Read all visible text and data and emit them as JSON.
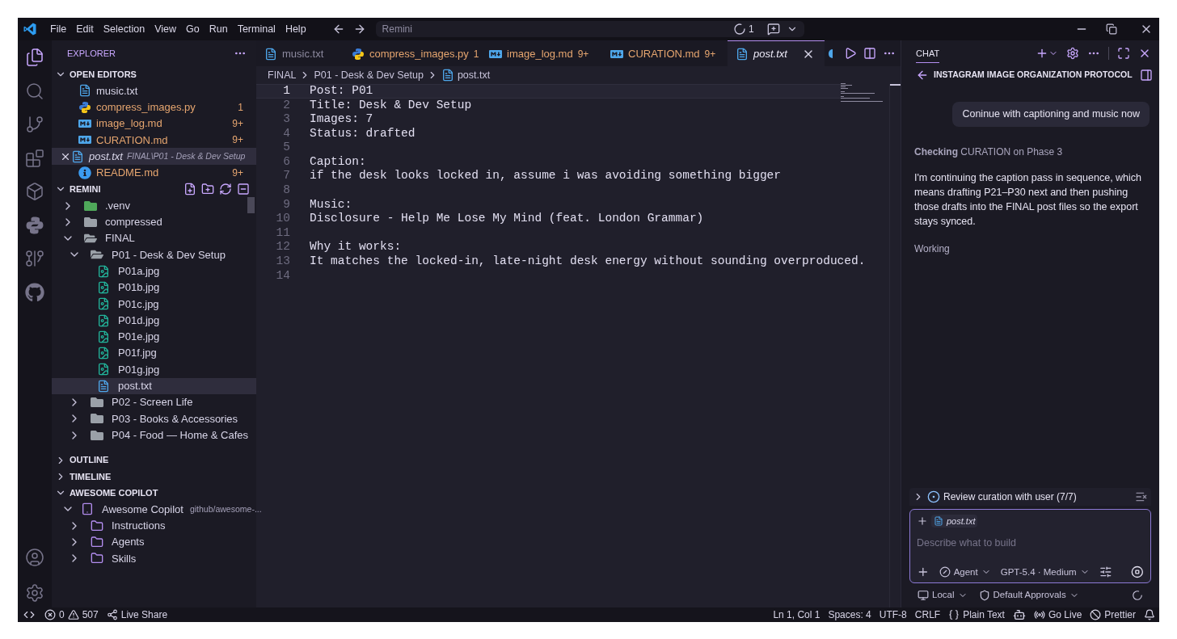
{
  "title_bar": {
    "menu": [
      "File",
      "Edit",
      "Selection",
      "View",
      "Go",
      "Run",
      "Terminal",
      "Help"
    ],
    "search": {
      "value": "Remini"
    },
    "progress_count": "1"
  },
  "activity_bar": {
    "top": [
      {
        "kind": "files",
        "selected": true
      },
      {
        "kind": "search",
        "selected": false
      },
      {
        "kind": "source-control",
        "selected": false
      },
      {
        "kind": "extensions",
        "selected": false
      },
      {
        "kind": "package",
        "selected": false
      },
      {
        "kind": "python",
        "selected": false
      },
      {
        "kind": "git-graph",
        "selected": false
      },
      {
        "kind": "github",
        "selected": false
      }
    ],
    "bottom": [
      {
        "kind": "account"
      },
      {
        "kind": "settings"
      }
    ]
  },
  "sidebar": {
    "title": "EXPLORER",
    "open_editors": {
      "label": "OPEN EDITORS",
      "expanded": true,
      "items": [
        {
          "name": "music.txt",
          "kind": "text",
          "modified": false,
          "preview": false,
          "selected": false
        },
        {
          "name": "compress_images.py",
          "kind": "python",
          "modified": true,
          "preview": false,
          "selected": false,
          "badge": "1"
        },
        {
          "name": "image_log.md",
          "kind": "markdown",
          "modified": true,
          "preview": false,
          "selected": false,
          "badge": "9+"
        },
        {
          "name": "CURATION.md",
          "kind": "markdown",
          "modified": true,
          "preview": false,
          "selected": false,
          "badge": "9+"
        },
        {
          "name": "post.txt",
          "kind": "text",
          "modified": false,
          "preview": true,
          "selected": true,
          "description": "FINAL\\P01 - Desk & Dev Setup"
        },
        {
          "name": "README.md",
          "kind": "info",
          "modified": true,
          "preview": false,
          "selected": false,
          "badge": "9+"
        }
      ]
    },
    "folder": {
      "label": "REMINI",
      "expanded": true,
      "tree": [
        {
          "name": ".venv",
          "kind": "venv",
          "expanded": false,
          "selected": false
        },
        {
          "name": "compressed",
          "kind": "folder",
          "expanded": false,
          "selected": false
        },
        {
          "name": "FINAL",
          "kind": "folder",
          "expanded": true,
          "selected": false,
          "children": [
            {
              "name": "P01 - Desk & Dev Setup",
              "kind": "folder",
              "expanded": true,
              "selected": false,
              "children": [
                {
                  "name": "P01a.jpg",
                  "kind": "image",
                  "selected": false
                },
                {
                  "name": "P01b.jpg",
                  "kind": "image",
                  "selected": false
                },
                {
                  "name": "P01c.jpg",
                  "kind": "image",
                  "selected": false
                },
                {
                  "name": "P01d.jpg",
                  "kind": "image",
                  "selected": false
                },
                {
                  "name": "P01e.jpg",
                  "kind": "image",
                  "selected": false
                },
                {
                  "name": "P01f.jpg",
                  "kind": "image",
                  "selected": false
                },
                {
                  "name": "P01g.jpg",
                  "kind": "image",
                  "selected": false
                },
                {
                  "name": "post.txt",
                  "kind": "text",
                  "selected": true
                }
              ]
            },
            {
              "name": "P02 - Screen Life",
              "kind": "folder",
              "expanded": false,
              "selected": false
            },
            {
              "name": "P03 - Books & Accessories",
              "kind": "folder",
              "expanded": false,
              "selected": false
            },
            {
              "name": "P04 - Food — Home & Cafes",
              "kind": "folder",
              "expanded": false,
              "selected": false
            }
          ]
        }
      ]
    },
    "sections": [
      {
        "label": "OUTLINE",
        "expanded": false
      },
      {
        "label": "TIMELINE",
        "expanded": false
      },
      {
        "label": "AWESOME COPILOT",
        "expanded": true,
        "tree": [
          {
            "name": "Awesome Copilot",
            "kind": "collection",
            "description": "github/awesome-...",
            "expanded": true,
            "selected": false,
            "children": [
              {
                "name": "Instructions",
                "kind": "category",
                "expanded": false,
                "selected": false
              },
              {
                "name": "Agents",
                "kind": "category",
                "expanded": false,
                "selected": false
              },
              {
                "name": "Skills",
                "kind": "category",
                "expanded": false,
                "selected": false
              }
            ]
          }
        ]
      }
    ]
  },
  "editor": {
    "tabs": [
      {
        "label": "music.txt",
        "kind": "text",
        "modified": false,
        "preview": false,
        "selected": false
      },
      {
        "label": "compress_images.py",
        "kind": "python",
        "modified": true,
        "preview": false,
        "selected": false,
        "badge": "1"
      },
      {
        "label": "image_log.md",
        "kind": "markdown",
        "modified": true,
        "preview": false,
        "selected": false,
        "badge": "9+"
      },
      {
        "label": "CURATION.md",
        "kind": "markdown",
        "modified": true,
        "preview": false,
        "selected": false,
        "badge": "9+"
      },
      {
        "label": "post.txt",
        "kind": "text",
        "modified": false,
        "preview": true,
        "selected": true
      }
    ],
    "breadcrumb": [
      "FINAL",
      "P01 - Desk & Dev Setup",
      "post.txt"
    ],
    "lines": [
      {
        "number": "1",
        "text": "Post: P01",
        "current": true
      },
      {
        "number": "2",
        "text": "Title: Desk & Dev Setup",
        "current": false
      },
      {
        "number": "3",
        "text": "Images: 7",
        "current": false
      },
      {
        "number": "4",
        "text": "Status: drafted",
        "current": false
      },
      {
        "number": "5",
        "current": false
      },
      {
        "number": "6",
        "text": "Caption:",
        "current": false
      },
      {
        "number": "7",
        "text": "if the desk looks locked in, assume i was avoiding something bigger",
        "current": false
      },
      {
        "number": "8",
        "current": false
      },
      {
        "number": "9",
        "text": "Music:",
        "current": false
      },
      {
        "number": "10",
        "text": "Disclosure - Help Me Lose My Mind (feat. London Grammar)",
        "current": false
      },
      {
        "number": "11",
        "current": false
      },
      {
        "number": "12",
        "text": "Why it works:",
        "current": false
      },
      {
        "number": "13",
        "text": "It matches the locked-in, late-night desk energy without sounding overproduced.",
        "current": false
      },
      {
        "number": "14",
        "current": false
      }
    ]
  },
  "chat": {
    "tab": "CHAT",
    "session_title": "INSTAGRAM IMAGE ORGANIZATION PROTOCOL",
    "messages": [
      {
        "kind": "user",
        "text": "Coninue with captioning and music now"
      },
      {
        "kind": "step",
        "text": "**Checking** CURATION on Phase 3"
      },
      {
        "kind": "assistant",
        "text": "I'm continuing the caption pass in sequence, which means drafting P21–P30 next and then pushing those drafts into the FINAL post files so the export stays synced."
      },
      {
        "kind": "status",
        "text": "Working"
      }
    ],
    "todo": {
      "label": "Review curation with user (7/7)",
      "expanded": false
    },
    "composer": {
      "attachment": "post.txt",
      "placeholder": "Describe what to build",
      "mode": "Agent",
      "model": "GPT-5.4 · Medium"
    },
    "footer": [
      {
        "kind": "location",
        "label": "Local"
      },
      {
        "kind": "approvals",
        "label": "Default Approvals"
      }
    ]
  },
  "status_bar": {
    "left": [
      {
        "kind": "problems",
        "errors": "0",
        "warnings": "507"
      },
      {
        "kind": "live-share",
        "label": "Live Share"
      }
    ],
    "right": [
      {
        "kind": "text",
        "label": "Ln 1, Col 1"
      },
      {
        "kind": "text",
        "label": "Spaces: 4"
      },
      {
        "kind": "text",
        "label": "UTF-8"
      },
      {
        "kind": "text",
        "label": "CRLF"
      },
      {
        "kind": "language",
        "label": "Plain Text"
      },
      {
        "kind": "copilot"
      },
      {
        "kind": "go-live",
        "label": "Go Live"
      },
      {
        "kind": "prettier",
        "label": "Prettier"
      },
      {
        "kind": "notifications"
      }
    ]
  }
}
